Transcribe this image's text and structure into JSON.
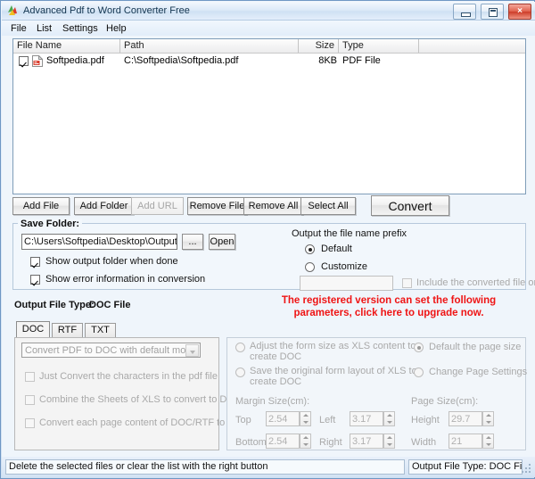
{
  "window": {
    "title": "Advanced Pdf to Word Converter Free",
    "app_icon": "app-logo-icon",
    "buttons": {
      "minimize": "minimize-icon",
      "maximize": "maximize-icon",
      "close": "×"
    }
  },
  "menu": {
    "items": [
      {
        "label": "File"
      },
      {
        "label": "List"
      },
      {
        "label": "Settings"
      },
      {
        "label": "Help"
      }
    ]
  },
  "file_list": {
    "columns": [
      "File Name",
      "Path",
      "Size",
      "Type"
    ],
    "rows": [
      {
        "checked": true,
        "icon": "pdf-file-icon",
        "name": "Softpedia.pdf",
        "path": "C:\\Softpedia\\Softpedia.pdf",
        "size": "8KB",
        "type": "PDF File"
      }
    ]
  },
  "toolbar": {
    "add_file": "Add File",
    "add_folder": "Add Folder",
    "add_url": "Add URL",
    "remove_file": "Remove File",
    "remove_all": "Remove All",
    "select_all": "Select All",
    "convert": "Convert"
  },
  "save_folder": {
    "legend": "Save Folder:",
    "path_value": "C:\\Users\\Softpedia\\Desktop\\Output Files",
    "browse_label": "...",
    "open_label": "Open",
    "show_output_folder": {
      "label": "Show output folder when done",
      "checked": true
    },
    "show_error_info": {
      "label": "Show error information in conversion",
      "checked": true
    }
  },
  "prefix": {
    "title": "Output the file name prefix",
    "options": [
      {
        "label": "Default",
        "selected": true
      },
      {
        "label": "Customize",
        "selected": false
      }
    ],
    "custom_value": "",
    "include_order": {
      "label": "Include the converted file order",
      "checked": false
    }
  },
  "upgrade_notice": {
    "line1": "The registered version can set the following",
    "line2": "parameters, click here to upgrade now."
  },
  "output_type": {
    "label": "Output File Type:",
    "value": "DOC File"
  },
  "tabs": [
    {
      "label": "DOC",
      "active": true
    },
    {
      "label": "RTF",
      "active": false
    },
    {
      "label": "TXT",
      "active": false
    }
  ],
  "doc_options": {
    "mode_combo": "Convert PDF to DOC with default mode",
    "checkboxes": [
      {
        "label": "Just Convert the characters in the pdf file",
        "checked": false
      },
      {
        "label": "Combine the Sheets of XLS to convert to DOC",
        "checked": false
      },
      {
        "label": "Convert each page content of DOC/RTF to single DOC",
        "checked": false
      }
    ]
  },
  "layout_options": {
    "left_radios": [
      {
        "line1": "Adjust the form size as XLS content to",
        "line2": "create DOC",
        "selected": false
      },
      {
        "line1": "Save the original form layout of XLS to",
        "line2": "create DOC",
        "selected": false
      }
    ],
    "right_radios": [
      {
        "label": "Default the page size",
        "selected": true
      },
      {
        "label": "Change Page Settings",
        "selected": false
      }
    ],
    "margin_title": "Margin Size(cm):",
    "page_title": "Page Size(cm):",
    "margins": [
      {
        "label": "Top",
        "value": "2.54"
      },
      {
        "label": "Left",
        "value": "3.17"
      },
      {
        "label": "Bottom",
        "value": "2.54"
      },
      {
        "label": "Right",
        "value": "3.17"
      }
    ],
    "page": [
      {
        "label": "Height",
        "value": "29.7"
      },
      {
        "label": "Width",
        "value": "21"
      }
    ]
  },
  "status_bar": {
    "hint": "Delete the selected files or clear the list with the right button",
    "right": "Output File Type:  DOC File"
  }
}
